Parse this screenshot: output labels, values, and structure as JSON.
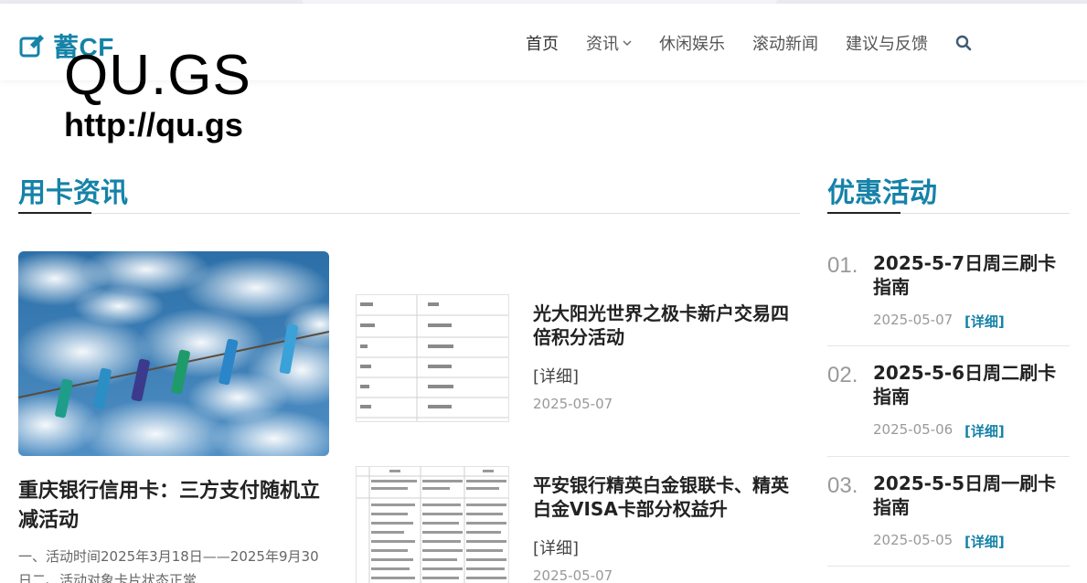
{
  "colors": {
    "brand": "#1582a8",
    "text": "#222222",
    "muted": "#999999"
  },
  "header": {
    "logo_text": "蓄CF",
    "logo_icon": "edit-icon",
    "nav": [
      {
        "label": "首页",
        "active": true
      },
      {
        "label": "资讯",
        "has_dropdown": true
      },
      {
        "label": "休闲娱乐"
      },
      {
        "label": "滚动新闻"
      },
      {
        "label": "建议与反馈"
      }
    ],
    "search_icon": "search-icon"
  },
  "watermark": {
    "big": "QU.GS",
    "small": "http://qu.gs"
  },
  "main": {
    "section_title": "用卡资讯",
    "feature": {
      "title": "重庆银行信用卡：三方支付随机立减活动",
      "excerpt": "一、活动时间2025年3月18日——2025年9月30日二、活动对象卡片状态正常"
    },
    "articles": [
      {
        "title": "光大阳光世界之极卡新户交易四倍积分活动",
        "more": "[详细]",
        "date": "2025-05-07"
      },
      {
        "title": "平安银行精英白金银联卡、精英白金VISA卡部分权益升",
        "more": "[详细]",
        "date": "2025-05-07"
      }
    ]
  },
  "sidebar": {
    "section_title": "优惠活动",
    "items": [
      {
        "num": "01.",
        "title": "2025-5-7日周三刷卡指南",
        "date": "2025-05-07",
        "more": "[详细]"
      },
      {
        "num": "02.",
        "title": "2025-5-6日周二刷卡指南",
        "date": "2025-05-06",
        "more": "[详细]"
      },
      {
        "num": "03.",
        "title": "2025-5-5日周一刷卡指南",
        "date": "2025-05-05",
        "more": "[详细]"
      }
    ]
  }
}
